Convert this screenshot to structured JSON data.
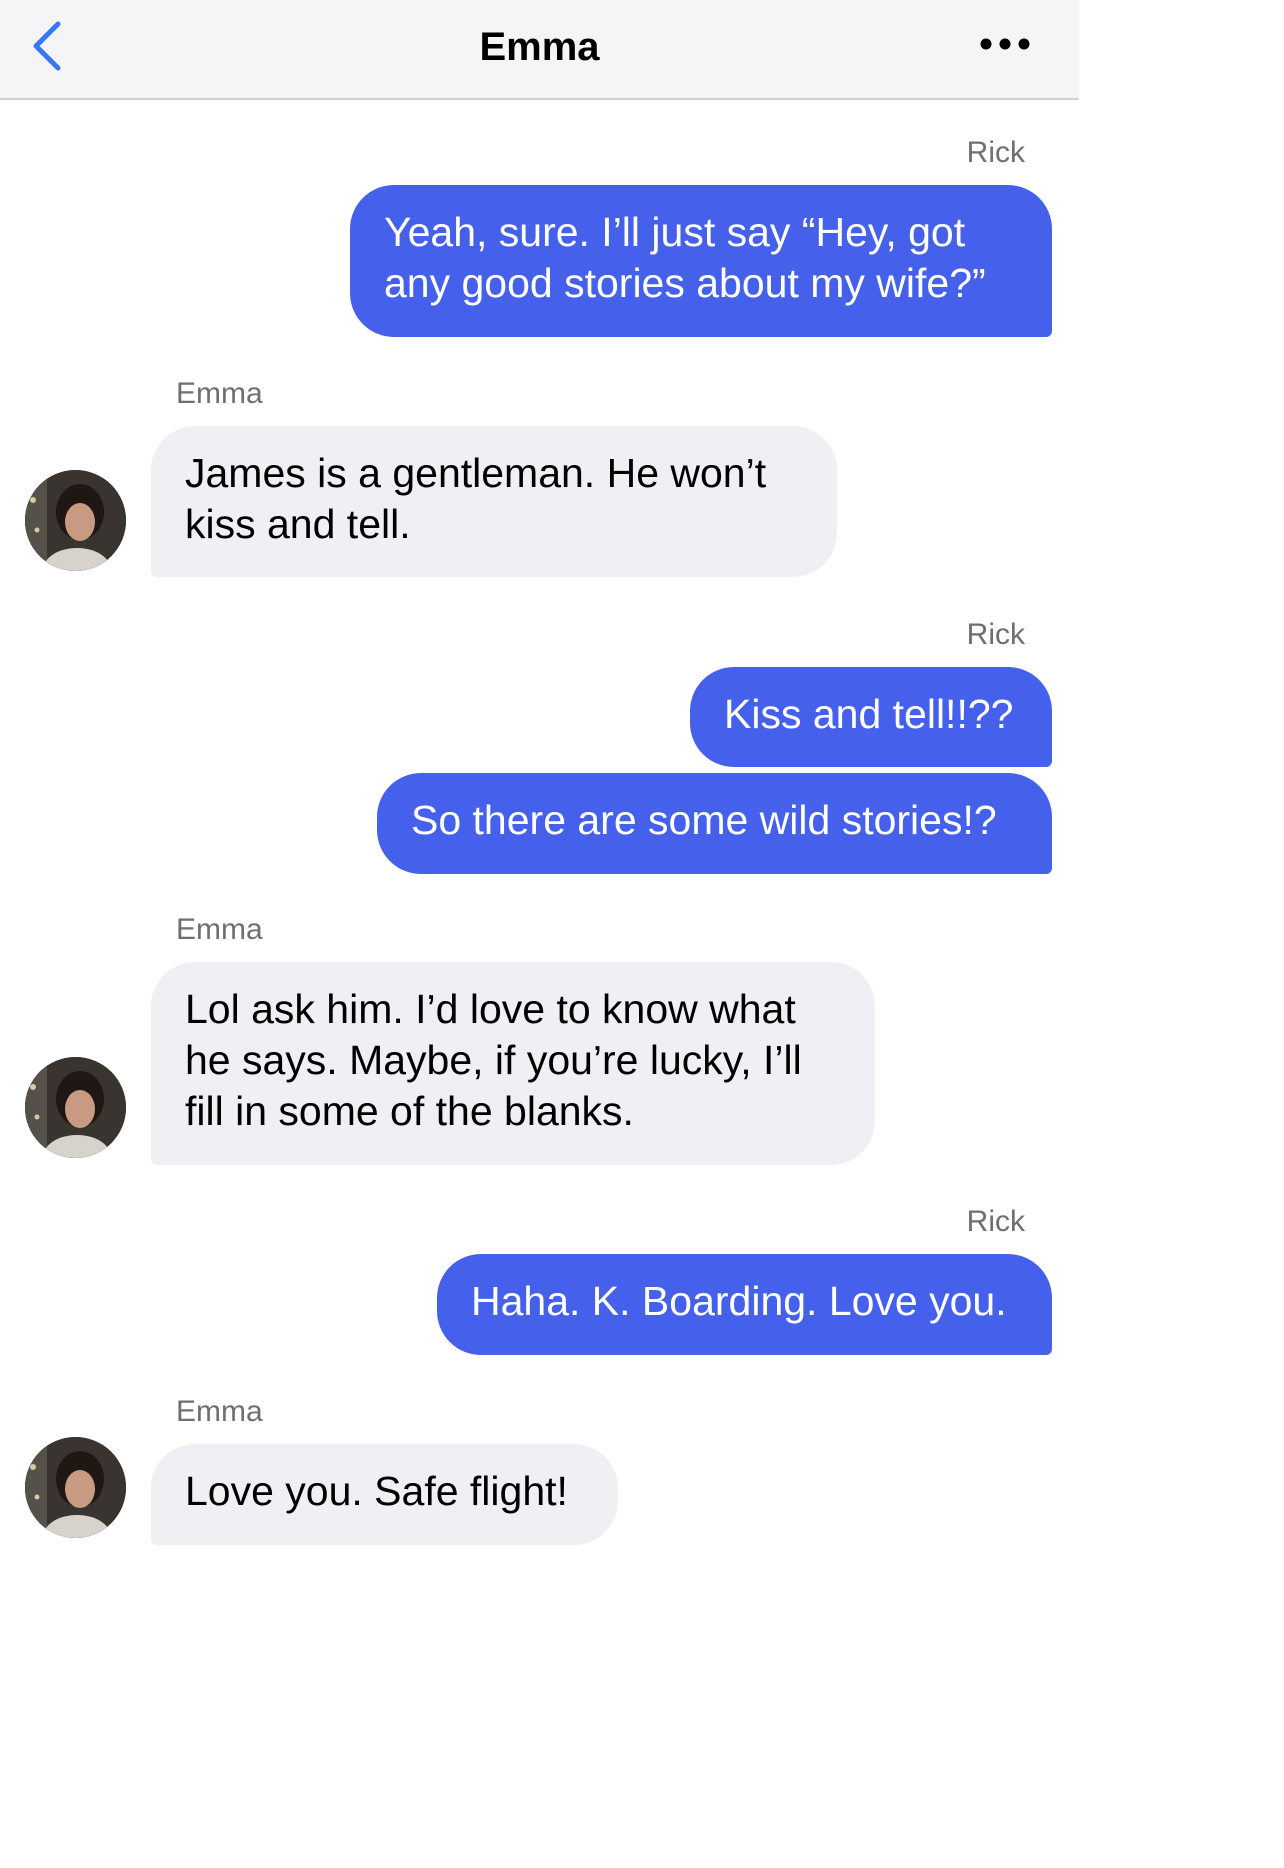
{
  "header": {
    "title": "Emma",
    "back_icon": "chevron-left-icon",
    "more_icon": "ellipsis-icon"
  },
  "colors": {
    "outgoing": "#4561ec",
    "incoming": "#f0f0f4",
    "accent": "#3478f6"
  },
  "messages": [
    {
      "sender": "Rick",
      "text": "Yeah, sure. I’ll just say “Hey, got any good stories about my wife?”"
    },
    {
      "sender": "Emma",
      "text": "James is a gentleman. He won’t kiss and tell."
    },
    {
      "sender": "Rick",
      "text": "Kiss and tell!!??"
    },
    {
      "text": "So there are some wild stories!?"
    },
    {
      "sender": "Emma",
      "text": "Lol ask him. I’d love to know what he says. Maybe, if you’re lucky, I’ll fill in some of the blanks."
    },
    {
      "sender": "Rick",
      "text": "Haha. K. Boarding. Love you."
    },
    {
      "sender": "Emma",
      "text": "Love you. Safe flight!"
    }
  ]
}
